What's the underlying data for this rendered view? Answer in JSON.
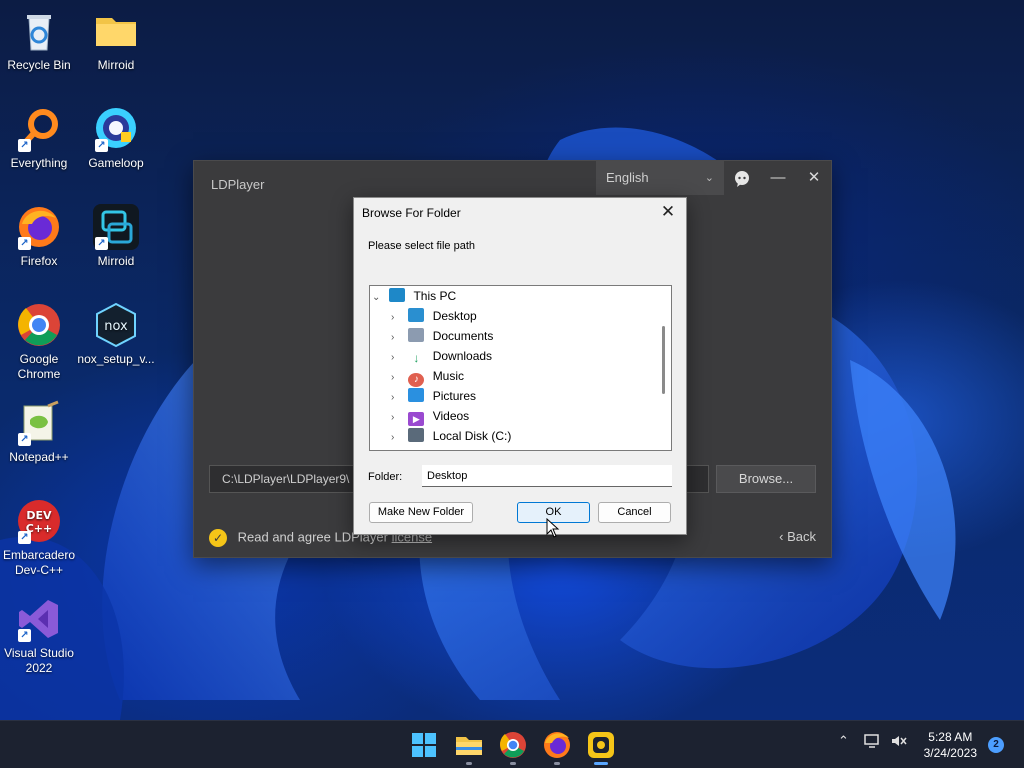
{
  "desktop": {
    "icons": [
      {
        "label": "Recycle Bin",
        "icon": "recycle-bin-icon",
        "shortcut": false
      },
      {
        "label": "Mirroid",
        "icon": "folder-icon",
        "shortcut": false
      },
      {
        "label": "Everything",
        "icon": "everything-search-icon",
        "shortcut": true
      },
      {
        "label": "Gameloop",
        "icon": "gameloop-icon",
        "shortcut": true
      },
      {
        "label": "Firefox",
        "icon": "firefox-icon",
        "shortcut": true
      },
      {
        "label": "Mirroid",
        "icon": "mirroid-app-icon",
        "shortcut": true
      },
      {
        "label": "Google Chrome",
        "icon": "chrome-icon",
        "shortcut": true
      },
      {
        "label": "nox_setup_v...",
        "icon": "nox-icon",
        "shortcut": false
      },
      {
        "label": "Notepad++",
        "icon": "notepadpp-icon",
        "shortcut": true
      },
      {
        "label": "Embarcadero Dev-C++",
        "icon": "devcpp-icon",
        "shortcut": true
      },
      {
        "label": "Visual Studio 2022",
        "icon": "visual-studio-icon",
        "shortcut": true
      }
    ]
  },
  "ldplayer": {
    "title": "LDPlayer",
    "language": "English",
    "install_path": "C:\\LDPlayer\\LDPlayer9\\",
    "browse_label": "Browse...",
    "agree_text": "Read and agree LDPlayer",
    "license_link": "license",
    "back_label": "Back"
  },
  "dialog": {
    "title": "Browse For Folder",
    "prompt": "Please select file path",
    "tree": [
      {
        "label": "This PC",
        "icon": "this-pc-icon",
        "expanded": true,
        "level": 0,
        "color": "#1e88c8"
      },
      {
        "label": "Desktop",
        "icon": "desktop-folder-icon",
        "expanded": false,
        "level": 1,
        "color": "#2a8fd0"
      },
      {
        "label": "Documents",
        "icon": "documents-folder-icon",
        "expanded": false,
        "level": 1,
        "color": "#8c9bb0"
      },
      {
        "label": "Downloads",
        "icon": "downloads-folder-icon",
        "expanded": false,
        "level": 1,
        "color": "#20a060"
      },
      {
        "label": "Music",
        "icon": "music-folder-icon",
        "expanded": false,
        "level": 1,
        "color": "#e06050"
      },
      {
        "label": "Pictures",
        "icon": "pictures-folder-icon",
        "expanded": false,
        "level": 1,
        "color": "#2a90e0"
      },
      {
        "label": "Videos",
        "icon": "videos-folder-icon",
        "expanded": false,
        "level": 1,
        "color": "#9a4ad0"
      },
      {
        "label": "Local Disk (C:)",
        "icon": "local-disk-icon",
        "expanded": false,
        "level": 1,
        "color": "#5a6a7a"
      }
    ],
    "folder_label": "Folder:",
    "folder_value": "Desktop",
    "make_new_folder": "Make New Folder",
    "ok": "OK",
    "cancel": "Cancel"
  },
  "taskbar": {
    "apps": [
      {
        "name": "start-button",
        "icon": "windows-logo-icon",
        "active": false,
        "running": false
      },
      {
        "name": "file-explorer",
        "icon": "file-explorer-icon",
        "active": false,
        "running": true
      },
      {
        "name": "chrome",
        "icon": "chrome-icon",
        "active": false,
        "running": true
      },
      {
        "name": "firefox",
        "icon": "firefox-icon",
        "active": false,
        "running": true
      },
      {
        "name": "ldplayer",
        "icon": "ldplayer-icon",
        "active": true,
        "running": true
      }
    ],
    "time": "5:28 AM",
    "date": "3/24/2023",
    "notifications": "2"
  }
}
